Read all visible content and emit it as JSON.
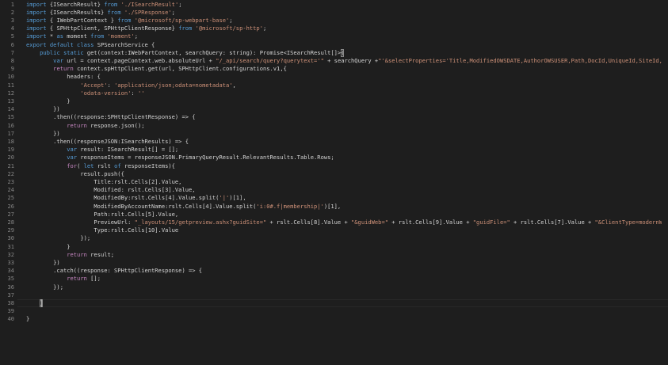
{
  "editor": {
    "line_numbers": [
      "1",
      "2",
      "3",
      "4",
      "5",
      "6",
      "7",
      "8",
      "9",
      "10",
      "11",
      "12",
      "13",
      "14",
      "15",
      "16",
      "17",
      "18",
      "19",
      "20",
      "21",
      "22",
      "23",
      "24",
      "25",
      "26",
      "27",
      "28",
      "29",
      "30",
      "31",
      "32",
      "33",
      "34",
      "35",
      "36",
      "37",
      "38",
      "39",
      "40"
    ],
    "lines": [
      [
        {
          "c": "kw",
          "t": "import "
        },
        {
          "c": "txt",
          "t": "{ISearchResult} "
        },
        {
          "c": "kw",
          "t": "from "
        },
        {
          "c": "str",
          "t": "'./ISearchResult'"
        },
        {
          "c": "txt",
          "t": ";"
        }
      ],
      [
        {
          "c": "kw",
          "t": "import "
        },
        {
          "c": "txt",
          "t": "{ISearchResults} "
        },
        {
          "c": "kw",
          "t": "from "
        },
        {
          "c": "str",
          "t": "'./SPResponse'"
        },
        {
          "c": "txt",
          "t": ";"
        }
      ],
      [
        {
          "c": "kw",
          "t": "import "
        },
        {
          "c": "txt",
          "t": "{ IWebPartContext } "
        },
        {
          "c": "kw",
          "t": "from "
        },
        {
          "c": "str",
          "t": "'@microsoft/sp-webpart-base'"
        },
        {
          "c": "txt",
          "t": ";"
        }
      ],
      [
        {
          "c": "kw",
          "t": "import "
        },
        {
          "c": "txt",
          "t": "{ SPHttpClient, SPHttpClientResponse} "
        },
        {
          "c": "kw",
          "t": "from "
        },
        {
          "c": "str",
          "t": "'@microsoft/sp-http'"
        },
        {
          "c": "txt",
          "t": ";"
        }
      ],
      [
        {
          "c": "kw",
          "t": "import "
        },
        {
          "c": "txt",
          "t": "* "
        },
        {
          "c": "kw",
          "t": "as "
        },
        {
          "c": "txt",
          "t": "moment "
        },
        {
          "c": "kw",
          "t": "from "
        },
        {
          "c": "str",
          "t": "'moment'"
        },
        {
          "c": "txt",
          "t": ";"
        }
      ],
      [
        {
          "c": "kw",
          "t": "export default class "
        },
        {
          "c": "txt",
          "t": "SPSearchService {"
        }
      ],
      [
        {
          "c": "txt",
          "t": "    "
        },
        {
          "c": "kw",
          "t": "public static "
        },
        {
          "c": "txt",
          "t": "get(context:IWebPartContext, searchQuery: string): Promise<ISearchResult[]>"
        },
        {
          "c": "box",
          "t": "{"
        }
      ],
      [
        {
          "c": "txt",
          "t": "        "
        },
        {
          "c": "kw",
          "t": "var "
        },
        {
          "c": "txt",
          "t": "url = context.pageContext.web.absoluteUrl + "
        },
        {
          "c": "str",
          "t": "\"/_api/search/query?querytext='\""
        },
        {
          "c": "txt",
          "t": " + searchQuery +"
        },
        {
          "c": "str",
          "t": "\"'&selectProperties='Title,ModifiedOWSDATE,AuthorOWSUSER,Path,DocId,UniqueId,SiteId,WebId,ListId"
        }
      ],
      [
        {
          "c": "txt",
          "t": "        "
        },
        {
          "c": "ctl",
          "t": "return "
        },
        {
          "c": "txt",
          "t": "context.spHttpClient.get(url, SPHttpClient.configurations.v1,{"
        }
      ],
      [
        {
          "c": "txt",
          "t": "            headers: {"
        }
      ],
      [
        {
          "c": "txt",
          "t": "                "
        },
        {
          "c": "str",
          "t": "'Accept'"
        },
        {
          "c": "txt",
          "t": ": "
        },
        {
          "c": "str",
          "t": "'application/json;odata=nometadata'"
        },
        {
          "c": "txt",
          "t": ","
        }
      ],
      [
        {
          "c": "txt",
          "t": "                "
        },
        {
          "c": "str",
          "t": "'odata-version'"
        },
        {
          "c": "txt",
          "t": ": "
        },
        {
          "c": "str",
          "t": "''"
        }
      ],
      [
        {
          "c": "txt",
          "t": "            }"
        }
      ],
      [
        {
          "c": "txt",
          "t": "        })"
        }
      ],
      [
        {
          "c": "txt",
          "t": "        .then((response:SPHttpClientResponse) => {"
        }
      ],
      [
        {
          "c": "txt",
          "t": "            "
        },
        {
          "c": "ctl",
          "t": "return "
        },
        {
          "c": "txt",
          "t": "response.json();"
        }
      ],
      [
        {
          "c": "txt",
          "t": "        })"
        }
      ],
      [
        {
          "c": "txt",
          "t": "        .then((responseJSON:ISearchResults) => {"
        }
      ],
      [
        {
          "c": "txt",
          "t": "            "
        },
        {
          "c": "kw",
          "t": "var "
        },
        {
          "c": "txt",
          "t": "result: ISearchResult[] = [];"
        }
      ],
      [
        {
          "c": "txt",
          "t": "            "
        },
        {
          "c": "kw",
          "t": "var "
        },
        {
          "c": "txt",
          "t": "responseItems = responseJSON.PrimaryQueryResult.RelevantResults.Table.Rows;"
        }
      ],
      [
        {
          "c": "txt",
          "t": "            "
        },
        {
          "c": "ctl",
          "t": "for"
        },
        {
          "c": "txt",
          "t": "( "
        },
        {
          "c": "kw",
          "t": "let "
        },
        {
          "c": "txt",
          "t": "rslt "
        },
        {
          "c": "kw",
          "t": "of "
        },
        {
          "c": "txt",
          "t": "responseItems){"
        }
      ],
      [
        {
          "c": "txt",
          "t": "                result.push({"
        }
      ],
      [
        {
          "c": "txt",
          "t": "                    Title:rslt.Cells[2].Value,"
        }
      ],
      [
        {
          "c": "txt",
          "t": "                    Modified: rslt.Cells[3].Value,"
        }
      ],
      [
        {
          "c": "txt",
          "t": "                    ModifiedBy:rslt.Cells[4].Value.split("
        },
        {
          "c": "str",
          "t": "'|'"
        },
        {
          "c": "txt",
          "t": ")[1],"
        }
      ],
      [
        {
          "c": "txt",
          "t": "                    ModifiedByAccountName:rslt.Cells[4].Value.split("
        },
        {
          "c": "str",
          "t": "'i:0#.f|membership|'"
        },
        {
          "c": "txt",
          "t": ")[1],"
        }
      ],
      [
        {
          "c": "txt",
          "t": "                    Path:rslt.Cells[5].Value,"
        }
      ],
      [
        {
          "c": "txt",
          "t": "                    PreviewUrl: "
        },
        {
          "c": "str",
          "t": "\"_layouts/15/getpreview.ashx?guidSite=\""
        },
        {
          "c": "txt",
          "t": " + rslt.Cells[8].Value + "
        },
        {
          "c": "str",
          "t": "\"&guidWeb=\""
        },
        {
          "c": "txt",
          "t": " + rslt.Cells[9].Value + "
        },
        {
          "c": "str",
          "t": "\"guidFile=\""
        },
        {
          "c": "txt",
          "t": " + rslt.Cells[7].Value + "
        },
        {
          "c": "str",
          "t": "\"&ClientType=modernWebPart\""
        },
        {
          "c": "txt",
          "t": ","
        }
      ],
      [
        {
          "c": "txt",
          "t": "                    Type:rslt.Cells[10].Value"
        }
      ],
      [
        {
          "c": "txt",
          "t": "                });"
        }
      ],
      [
        {
          "c": "txt",
          "t": "            }"
        }
      ],
      [
        {
          "c": "txt",
          "t": "            "
        },
        {
          "c": "ctl",
          "t": "return "
        },
        {
          "c": "txt",
          "t": "result;"
        }
      ],
      [
        {
          "c": "txt",
          "t": "        })"
        }
      ],
      [
        {
          "c": "txt",
          "t": "        .catch((response: SPHttpClientResponse) => {"
        }
      ],
      [
        {
          "c": "txt",
          "t": "            "
        },
        {
          "c": "ctl",
          "t": "return "
        },
        {
          "c": "txt",
          "t": "[];"
        }
      ],
      [
        {
          "c": "txt",
          "t": "        });"
        }
      ],
      [],
      [
        {
          "c": "txt",
          "t": "    "
        },
        {
          "c": "box",
          "t": "}"
        }
      ],
      [],
      [
        {
          "c": "txt",
          "t": "}"
        }
      ]
    ]
  },
  "colors": {
    "background": "#1e1e1e",
    "keyword": "#569cd6",
    "control": "#c586c0",
    "string": "#ce9178",
    "text": "#d4d4d4",
    "line_number": "#858585"
  }
}
